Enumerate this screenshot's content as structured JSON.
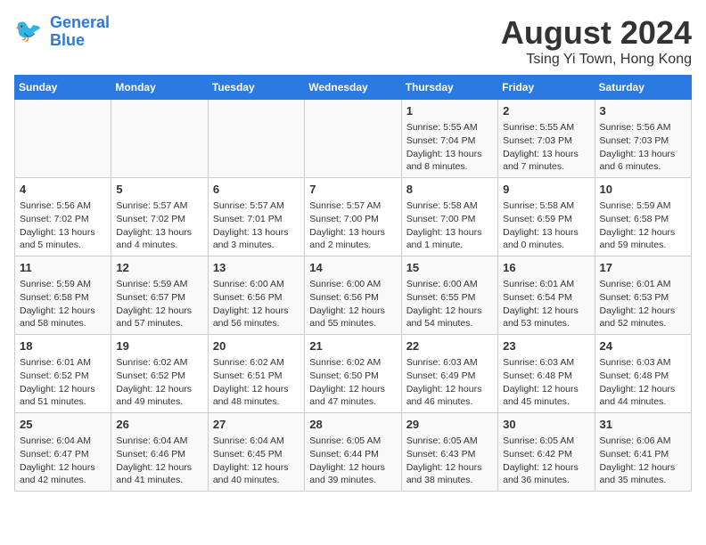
{
  "header": {
    "logo_line1": "General",
    "logo_line2": "Blue",
    "month_year": "August 2024",
    "location": "Tsing Yi Town, Hong Kong"
  },
  "weekdays": [
    "Sunday",
    "Monday",
    "Tuesday",
    "Wednesday",
    "Thursday",
    "Friday",
    "Saturday"
  ],
  "weeks": [
    [
      {
        "day": "",
        "info": ""
      },
      {
        "day": "",
        "info": ""
      },
      {
        "day": "",
        "info": ""
      },
      {
        "day": "",
        "info": ""
      },
      {
        "day": "1",
        "info": "Sunrise: 5:55 AM\nSunset: 7:04 PM\nDaylight: 13 hours\nand 8 minutes."
      },
      {
        "day": "2",
        "info": "Sunrise: 5:55 AM\nSunset: 7:03 PM\nDaylight: 13 hours\nand 7 minutes."
      },
      {
        "day": "3",
        "info": "Sunrise: 5:56 AM\nSunset: 7:03 PM\nDaylight: 13 hours\nand 6 minutes."
      }
    ],
    [
      {
        "day": "4",
        "info": "Sunrise: 5:56 AM\nSunset: 7:02 PM\nDaylight: 13 hours\nand 5 minutes."
      },
      {
        "day": "5",
        "info": "Sunrise: 5:57 AM\nSunset: 7:02 PM\nDaylight: 13 hours\nand 4 minutes."
      },
      {
        "day": "6",
        "info": "Sunrise: 5:57 AM\nSunset: 7:01 PM\nDaylight: 13 hours\nand 3 minutes."
      },
      {
        "day": "7",
        "info": "Sunrise: 5:57 AM\nSunset: 7:00 PM\nDaylight: 13 hours\nand 2 minutes."
      },
      {
        "day": "8",
        "info": "Sunrise: 5:58 AM\nSunset: 7:00 PM\nDaylight: 13 hours\nand 1 minute."
      },
      {
        "day": "9",
        "info": "Sunrise: 5:58 AM\nSunset: 6:59 PM\nDaylight: 13 hours\nand 0 minutes."
      },
      {
        "day": "10",
        "info": "Sunrise: 5:59 AM\nSunset: 6:58 PM\nDaylight: 12 hours\nand 59 minutes."
      }
    ],
    [
      {
        "day": "11",
        "info": "Sunrise: 5:59 AM\nSunset: 6:58 PM\nDaylight: 12 hours\nand 58 minutes."
      },
      {
        "day": "12",
        "info": "Sunrise: 5:59 AM\nSunset: 6:57 PM\nDaylight: 12 hours\nand 57 minutes."
      },
      {
        "day": "13",
        "info": "Sunrise: 6:00 AM\nSunset: 6:56 PM\nDaylight: 12 hours\nand 56 minutes."
      },
      {
        "day": "14",
        "info": "Sunrise: 6:00 AM\nSunset: 6:56 PM\nDaylight: 12 hours\nand 55 minutes."
      },
      {
        "day": "15",
        "info": "Sunrise: 6:00 AM\nSunset: 6:55 PM\nDaylight: 12 hours\nand 54 minutes."
      },
      {
        "day": "16",
        "info": "Sunrise: 6:01 AM\nSunset: 6:54 PM\nDaylight: 12 hours\nand 53 minutes."
      },
      {
        "day": "17",
        "info": "Sunrise: 6:01 AM\nSunset: 6:53 PM\nDaylight: 12 hours\nand 52 minutes."
      }
    ],
    [
      {
        "day": "18",
        "info": "Sunrise: 6:01 AM\nSunset: 6:52 PM\nDaylight: 12 hours\nand 51 minutes."
      },
      {
        "day": "19",
        "info": "Sunrise: 6:02 AM\nSunset: 6:52 PM\nDaylight: 12 hours\nand 49 minutes."
      },
      {
        "day": "20",
        "info": "Sunrise: 6:02 AM\nSunset: 6:51 PM\nDaylight: 12 hours\nand 48 minutes."
      },
      {
        "day": "21",
        "info": "Sunrise: 6:02 AM\nSunset: 6:50 PM\nDaylight: 12 hours\nand 47 minutes."
      },
      {
        "day": "22",
        "info": "Sunrise: 6:03 AM\nSunset: 6:49 PM\nDaylight: 12 hours\nand 46 minutes."
      },
      {
        "day": "23",
        "info": "Sunrise: 6:03 AM\nSunset: 6:48 PM\nDaylight: 12 hours\nand 45 minutes."
      },
      {
        "day": "24",
        "info": "Sunrise: 6:03 AM\nSunset: 6:48 PM\nDaylight: 12 hours\nand 44 minutes."
      }
    ],
    [
      {
        "day": "25",
        "info": "Sunrise: 6:04 AM\nSunset: 6:47 PM\nDaylight: 12 hours\nand 42 minutes."
      },
      {
        "day": "26",
        "info": "Sunrise: 6:04 AM\nSunset: 6:46 PM\nDaylight: 12 hours\nand 41 minutes."
      },
      {
        "day": "27",
        "info": "Sunrise: 6:04 AM\nSunset: 6:45 PM\nDaylight: 12 hours\nand 40 minutes."
      },
      {
        "day": "28",
        "info": "Sunrise: 6:05 AM\nSunset: 6:44 PM\nDaylight: 12 hours\nand 39 minutes."
      },
      {
        "day": "29",
        "info": "Sunrise: 6:05 AM\nSunset: 6:43 PM\nDaylight: 12 hours\nand 38 minutes."
      },
      {
        "day": "30",
        "info": "Sunrise: 6:05 AM\nSunset: 6:42 PM\nDaylight: 12 hours\nand 36 minutes."
      },
      {
        "day": "31",
        "info": "Sunrise: 6:06 AM\nSunset: 6:41 PM\nDaylight: 12 hours\nand 35 minutes."
      }
    ]
  ]
}
